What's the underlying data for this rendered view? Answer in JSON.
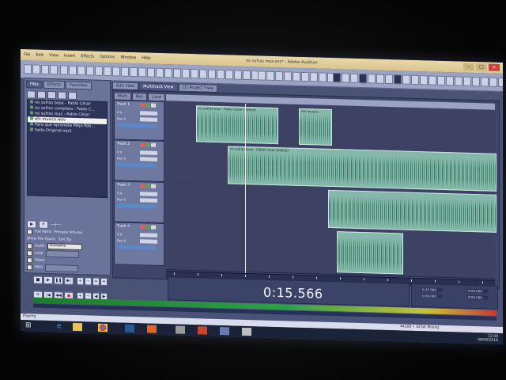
{
  "window": {
    "title": "no sufras mas.ses* - Adobe Audition"
  },
  "menu": [
    "File",
    "Edit",
    "View",
    "Insert",
    "Effects",
    "Options",
    "Window",
    "Help"
  ],
  "left_panel": {
    "tabs": [
      "Files",
      "Effects",
      "Favorites"
    ],
    "files": [
      "no sufras base - Pablo César",
      "no sufras completa - Pablo C...",
      "no sufras mas - Pablo César",
      "efx musica.wav",
      "Para que Aprendas Mejo Pab...",
      "Sello-Original.mp3"
    ],
    "selected_file_index": 3,
    "full_paths_label": "Full Paths",
    "autoplay_label": "Auto Play",
    "preview_volume_label": "Preview Volume",
    "show_file_types_label": "Show File Types:",
    "sort_by_label": "Sort By:",
    "sort_by_value": "Filename",
    "file_types": [
      "Audio",
      "Loop",
      "Video",
      "MIDI"
    ]
  },
  "view_tabs": [
    "Edit View",
    "Multitrack View",
    "CD Project View"
  ],
  "active_view_tab": 1,
  "sub_tabs": [
    "Main",
    "Bus",
    "Lane"
  ],
  "tracks": [
    {
      "name": "Track 1",
      "vol": "V 0",
      "pan": "Pan 0"
    },
    {
      "name": "Track 2",
      "vol": "V 0",
      "pan": "Pan 0"
    },
    {
      "name": "Track 3",
      "vol": "V 0",
      "pan": "Pan 0"
    },
    {
      "name": "Track 4",
      "vol": "V 0",
      "pan": "Pan 0"
    }
  ],
  "clips": [
    {
      "track": 0,
      "label": "no sufras mas - Pablo César (Edited)"
    },
    {
      "track": 0,
      "label": "efx musica"
    },
    {
      "track": 1,
      "label": "no sufras base - Pablo César (Edited)"
    },
    {
      "track": 2,
      "label": ""
    },
    {
      "track": 3,
      "label": ""
    }
  ],
  "time_display": "0:15.566",
  "selection_info": [
    "0:15.566",
    "0:00.000",
    "0:00.000",
    "0:00.000"
  ],
  "status_bar": {
    "left": "Playing",
    "right": "44100 • 32-bit Mixing"
  },
  "taskbar": {
    "time": "12:08",
    "date": "09/09/2016"
  },
  "colors": {
    "app_bg": "#4a5276",
    "clip": "#84b9aa",
    "title_bar": "#e9d8a8",
    "meter_green": "#2fa04a"
  },
  "icons": [
    "windows-start-icon",
    "ie-icon",
    "folder-icon",
    "chrome-icon",
    "word-icon",
    "media-icon",
    "audition-icon"
  ]
}
